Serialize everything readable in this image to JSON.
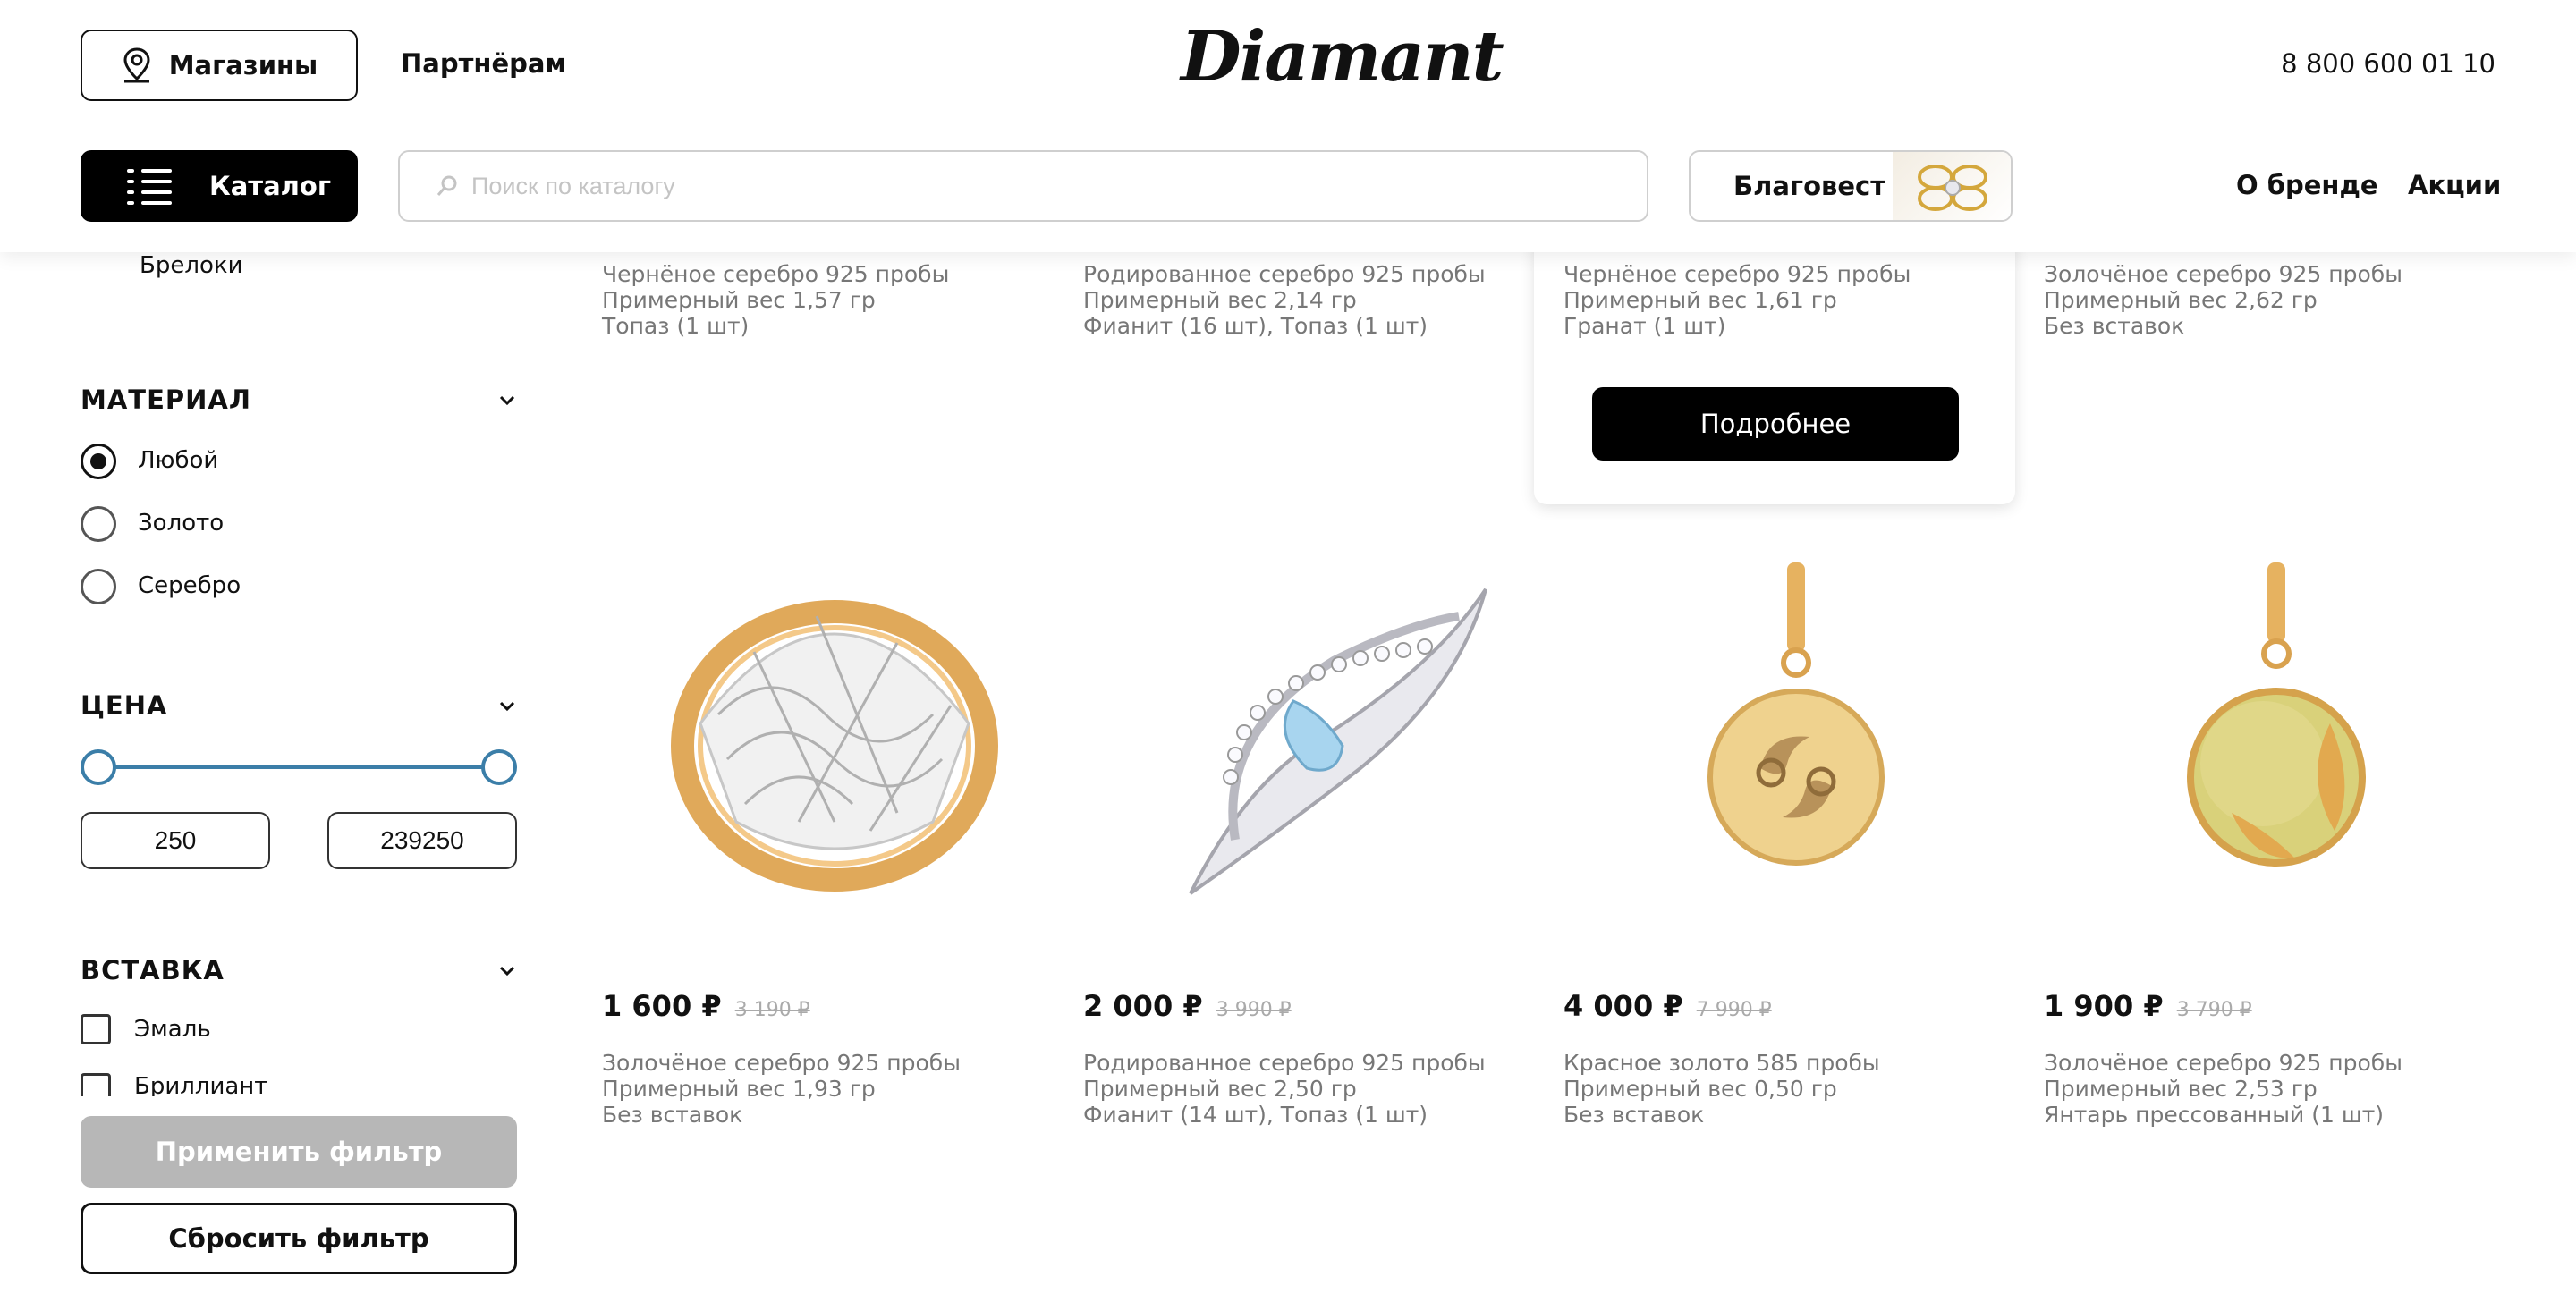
{
  "header": {
    "stores_label": "Магазины",
    "partners_label": "Партнёрам",
    "logo_text": "Diamant",
    "phone": "8 800 600 01 10",
    "catalog_label": "Каталог",
    "search_placeholder": "Поиск по каталогу",
    "brand_label": "Благовест",
    "about_label": "О бренде",
    "promo_label": "Акции"
  },
  "sidebar": {
    "cut_item": "Брелоки",
    "material": {
      "title": "МАТЕРИАЛ",
      "options": [
        "Любой",
        "Золото",
        "Серебро"
      ],
      "selected": "Любой"
    },
    "price": {
      "title": "ЦЕНА",
      "min": "250",
      "max": "239250"
    },
    "insert": {
      "title": "ВСТАВКА",
      "options": [
        "Эмаль",
        "Бриллиант"
      ]
    },
    "apply_label": "Применить фильтр",
    "reset_label": "Сбросить фильтр"
  },
  "top_row": [
    {
      "metal": "Чернёное серебро 925 пробы",
      "weight": "Примерный вес 1,57 гр",
      "insert": "Топаз (1 шт)"
    },
    {
      "metal": "Родированное серебро 925 пробы",
      "weight": "Примерный вес 2,14 гр",
      "insert": "Фианит (16 шт), Топаз (1 шт)"
    },
    {
      "metal": "Чернёное серебро 925 пробы",
      "weight": "Примерный вес 1,61 гр",
      "insert": "Гранат (1 шт)"
    },
    {
      "metal": "Золочёное серебро 925 пробы",
      "weight": "Примерный вес 2,62 гр",
      "insert": "Без вставок"
    }
  ],
  "detail_label": "Подробнее",
  "products": [
    {
      "price": "1 600 ₽",
      "old_price": "3 190 ₽",
      "metal": "Золочёное серебро 925 пробы",
      "weight": "Примерный вес 1,93 гр",
      "insert": "Без вставок",
      "icon": "ring-icon"
    },
    {
      "price": "2 000 ₽",
      "old_price": "3 990 ₽",
      "metal": "Родированное серебро 925 пробы",
      "weight": "Примерный вес 2,50 гр",
      "insert": "Фианит (14 шт), Топаз (1 шт)",
      "icon": "brooch-icon"
    },
    {
      "price": "4 000 ₽",
      "old_price": "7 990 ₽",
      "metal": "Красное золото 585 пробы",
      "weight": "Примерный вес 0,50 гр",
      "insert": "Без вставок",
      "icon": "cancer-pendant-icon"
    },
    {
      "price": "1 900 ₽",
      "old_price": "3 790 ₽",
      "metal": "Золочёное серебро 925 пробы",
      "weight": "Примерный вес 2,53 гр",
      "insert": "Янтарь прессованный (1 шт)",
      "icon": "amber-pendant-icon"
    }
  ]
}
